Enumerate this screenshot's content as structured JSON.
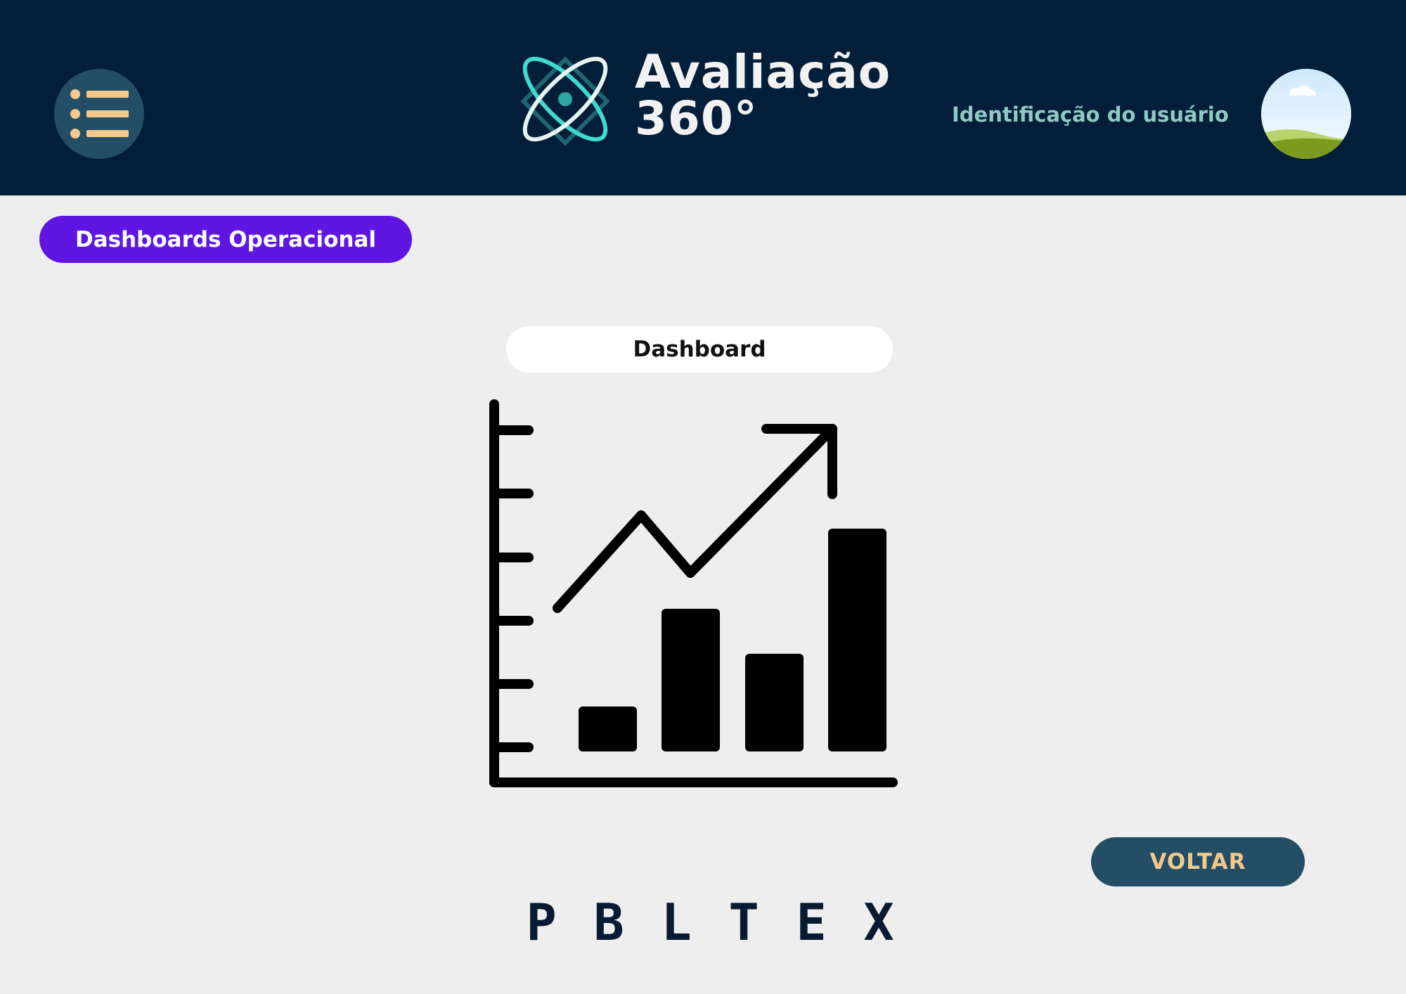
{
  "header": {
    "menu_icon": "list-icon",
    "logo_icon": "atom-icon",
    "title_line1": "Avaliação",
    "title_line2": "360°",
    "user_label": "Identificação do usuário",
    "avatar_icon": "landscape-avatar-icon"
  },
  "section": {
    "label": "Dashboards Operacional"
  },
  "dashboard": {
    "label": "Dashboard",
    "icon": "growth-chart-icon"
  },
  "actions": {
    "back_label": "VOLTAR"
  },
  "brand": {
    "letters": [
      "P",
      "B",
      "L",
      "T",
      "E",
      "X"
    ]
  },
  "colors": {
    "header_bg": "#031e39",
    "accent_purple": "#5f16e3",
    "button_bg": "#234e66",
    "button_text": "#f3c98c",
    "user_label": "#8ec9c3",
    "page_bg": "#eeeeee"
  }
}
